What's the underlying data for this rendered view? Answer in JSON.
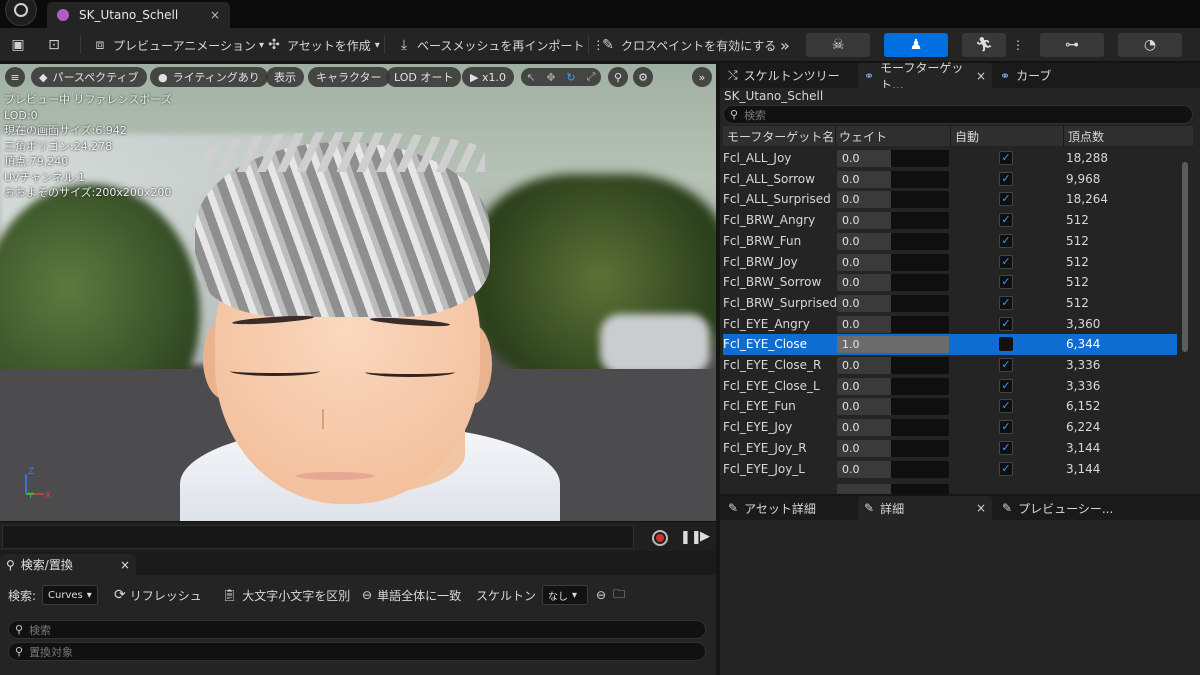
{
  "window": {
    "tab_title": "SK_Utano_Schell",
    "tab_close": "×"
  },
  "toolbar": {
    "preview_animation": "プレビューアニメーション",
    "create_asset": "アセットを作成",
    "reimport_base_mesh": "ベースメッシュを再インポート",
    "enable_cloth_paint": "クロスペイントを有効にする",
    "more": "»"
  },
  "viewport": {
    "menu_icon": "≡",
    "perspective": "パースペクティブ",
    "lighting": "ライティングあり",
    "show": "表示",
    "character": "キャラクター",
    "lod": "LOD オート",
    "play_speed": "▶ x1.0",
    "expand": "»",
    "stats": [
      "プレビュー中 リファレンスポーズ",
      "LOD:0",
      "現在の画面サイズ:6.942",
      "三角ポリゴン:24,278",
      "頂点:79,240",
      "UVチャンネル:1",
      "おおよそのサイズ:200x200x200"
    ],
    "axis_z": "Z",
    "axis_y": "Y",
    "axis_x": "X"
  },
  "search_replace": {
    "tab_label": "検索/置換",
    "tab_close": "×",
    "search_label": "検索:",
    "search_type": "Curves",
    "refresh": "リフレッシュ",
    "match_case": "大文字小文字を区別",
    "whole_word": "単語全体に一致",
    "skeleton_label": "スケルトン",
    "skeleton_value": "なし",
    "search_placeholder": "検索",
    "replace_placeholder": "置換対象"
  },
  "right_panel": {
    "tabs": [
      {
        "label": "スケルトンツリー"
      },
      {
        "label": "モーフターゲット...",
        "close": "×"
      },
      {
        "label": "カーブ"
      }
    ],
    "mesh_name": "SK_Utano_Schell",
    "search_placeholder": "検索",
    "columns": {
      "name": "モーフターゲット名",
      "weight": "ウェイト",
      "auto": "自動",
      "vertices": "頂点数"
    },
    "morph_targets": [
      {
        "name": "Fcl_ALL_Joy",
        "weight": "0.0",
        "auto": true,
        "vertices": "18,288"
      },
      {
        "name": "Fcl_ALL_Sorrow",
        "weight": "0.0",
        "auto": true,
        "vertices": "9,968"
      },
      {
        "name": "Fcl_ALL_Surprised",
        "weight": "0.0",
        "auto": true,
        "vertices": "18,264"
      },
      {
        "name": "Fcl_BRW_Angry",
        "weight": "0.0",
        "auto": true,
        "vertices": "512"
      },
      {
        "name": "Fcl_BRW_Fun",
        "weight": "0.0",
        "auto": true,
        "vertices": "512"
      },
      {
        "name": "Fcl_BRW_Joy",
        "weight": "0.0",
        "auto": true,
        "vertices": "512"
      },
      {
        "name": "Fcl_BRW_Sorrow",
        "weight": "0.0",
        "auto": true,
        "vertices": "512"
      },
      {
        "name": "Fcl_BRW_Surprised",
        "weight": "0.0",
        "auto": true,
        "vertices": "512"
      },
      {
        "name": "Fcl_EYE_Angry",
        "weight": "0.0",
        "auto": true,
        "vertices": "3,360"
      },
      {
        "name": "Fcl_EYE_Close",
        "weight": "1.0",
        "auto": false,
        "vertices": "6,344",
        "selected": true
      },
      {
        "name": "Fcl_EYE_Close_R",
        "weight": "0.0",
        "auto": true,
        "vertices": "3,336"
      },
      {
        "name": "Fcl_EYE_Close_L",
        "weight": "0.0",
        "auto": true,
        "vertices": "3,336"
      },
      {
        "name": "Fcl_EYE_Fun",
        "weight": "0.0",
        "auto": true,
        "vertices": "6,152"
      },
      {
        "name": "Fcl_EYE_Joy",
        "weight": "0.0",
        "auto": true,
        "vertices": "6,224"
      },
      {
        "name": "Fcl_EYE_Joy_R",
        "weight": "0.0",
        "auto": true,
        "vertices": "3,144"
      },
      {
        "name": "Fcl_EYE_Joy_L",
        "weight": "0.0",
        "auto": true,
        "vertices": "3,144"
      }
    ]
  },
  "bottom_panel": {
    "tabs": [
      {
        "label": "アセット詳細"
      },
      {
        "label": "詳細",
        "close": "×"
      },
      {
        "label": "プレビューシー..."
      }
    ]
  },
  "colors": {
    "accent": "#0f6cd1",
    "active_mode": "#0070e0",
    "record": "#d32f2f"
  }
}
